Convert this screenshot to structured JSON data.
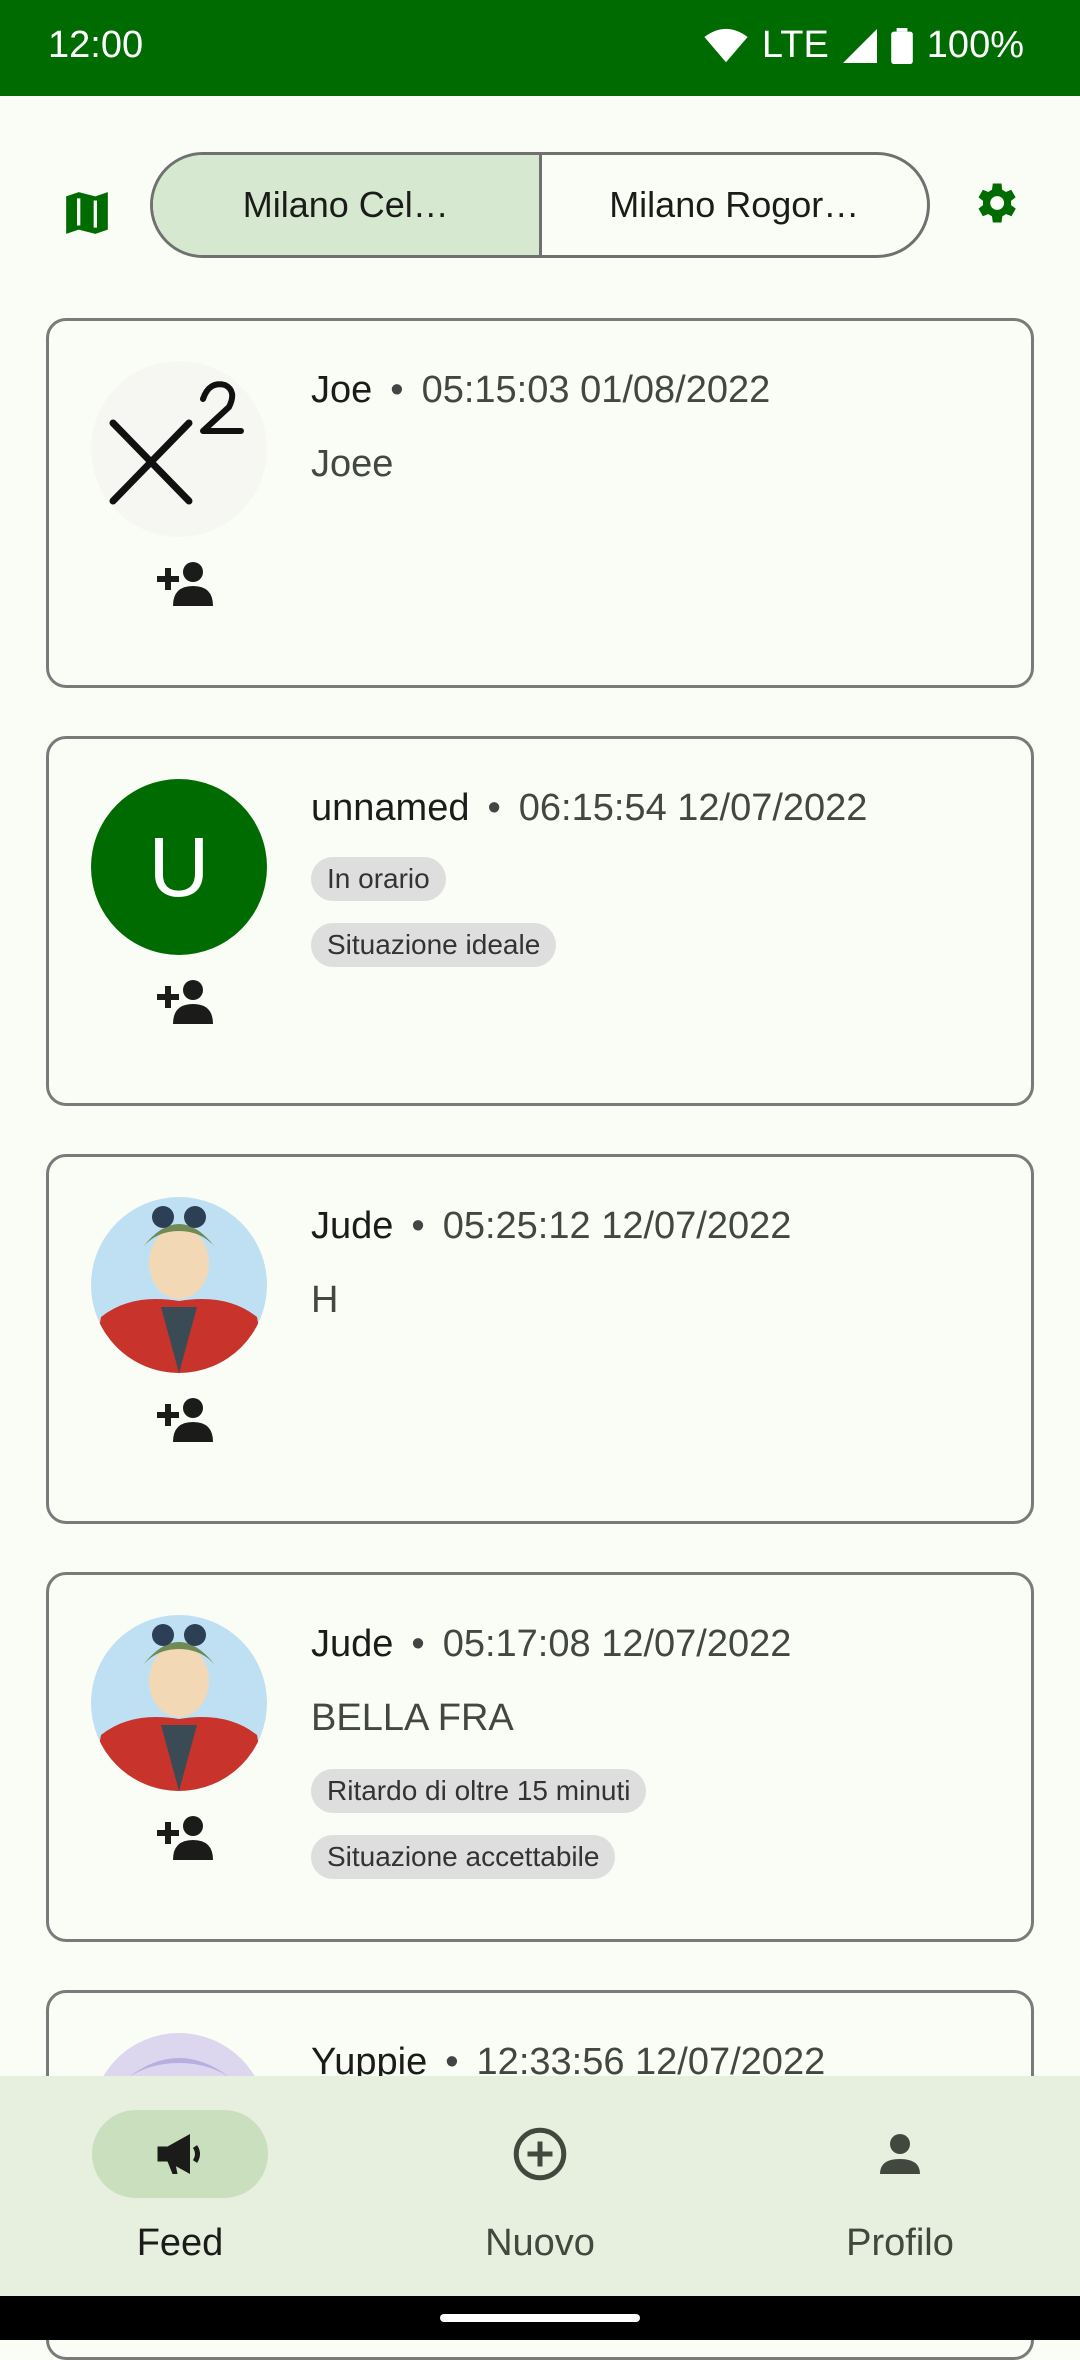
{
  "status_bar": {
    "time": "12:00",
    "network": "LTE",
    "battery": "100%"
  },
  "top": {
    "segments": [
      "Milano Cel…",
      "Milano Rogor…"
    ],
    "selected_segment": 0
  },
  "feed": [
    {
      "user": "Joe",
      "time": "05:15:03 01/08/2022",
      "message": "Joee",
      "tags": [],
      "avatar": "math-symbol"
    },
    {
      "user": "unnamed",
      "time": "06:15:54 12/07/2022",
      "message": "",
      "tags": [
        "In orario",
        "Situazione ideale"
      ],
      "avatar_letter": "U"
    },
    {
      "user": "Jude",
      "time": "05:25:12 12/07/2022",
      "message": "H",
      "tags": [],
      "avatar": "anime-character"
    },
    {
      "user": "Jude",
      "time": "05:17:08 12/07/2022",
      "message": "BELLA FRA",
      "tags": [
        "Ritardo di oltre 15 minuti",
        "Situazione accettabile"
      ],
      "avatar": "anime-character"
    },
    {
      "user": "Yuppie",
      "time": "12:33:56 12/07/2022",
      "message": "",
      "tags": [],
      "avatar": "anime-character-lavender"
    }
  ],
  "bottom_nav": [
    {
      "label": "Feed",
      "icon": "megaphone-icon",
      "active": true
    },
    {
      "label": "Nuovo",
      "icon": "add-circle-icon",
      "active": false
    },
    {
      "label": "Profilo",
      "icon": "person-icon",
      "active": false
    }
  ],
  "colors": {
    "primary": "#006b00",
    "selected_segment": "#d6e8cf",
    "nav_background": "#e7efdf",
    "chip": "#dedede"
  }
}
